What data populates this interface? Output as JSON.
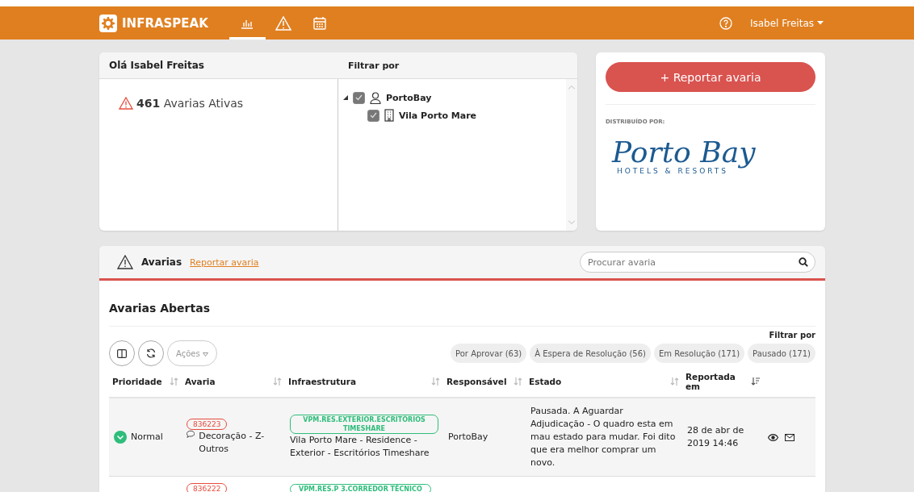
{
  "header": {
    "logo": "INFRASPEAK",
    "nav": [
      {
        "kind": "chart",
        "selected": true
      },
      {
        "kind": "alert",
        "selected": false
      },
      {
        "kind": "calendar",
        "selected": false
      }
    ],
    "user": "Isabel Freitas"
  },
  "welcome": {
    "title": "Olá Isabel Freitas",
    "count": "461",
    "count_label": "Avarias Ativas"
  },
  "filter": {
    "title": "Filtrar por",
    "tree": [
      {
        "label": "PortoBay",
        "kind": "client",
        "checked": true,
        "expanded": true,
        "children": [
          {
            "label": "Vila Porto Mare",
            "kind": "building",
            "checked": true
          }
        ]
      }
    ]
  },
  "promo": {
    "report_button": "+ Reportar avaria",
    "distributed_by": "DISTRIBUÍDO POR:",
    "brand": "Porto Bay",
    "brand_sub": "HOTELS & RESORTS"
  },
  "avarias": {
    "title": "Avarias",
    "report_link": "Reportar avaria",
    "search_placeholder": "Procurar avaria",
    "section_title": "Avarias Abertas",
    "filter_label": "Filtrar por",
    "actions": "Ações",
    "filters": [
      {
        "label": "Por Aprovar (63)"
      },
      {
        "label": "À Espera de Resolução (56)"
      },
      {
        "label": "Em Resolução (171)"
      },
      {
        "label": "Pausado (171)"
      }
    ],
    "columns": [
      {
        "label": "Prioridade",
        "sorted": false
      },
      {
        "label": "Avaria",
        "sorted": false
      },
      {
        "label": "Infraestrutura",
        "sorted": false
      },
      {
        "label": "Responsável",
        "sorted": false
      },
      {
        "label": "Estado",
        "sorted": false
      },
      {
        "label": "Reportada em",
        "sorted": true
      }
    ],
    "rows": [
      {
        "priority": "Normal",
        "code": "836223",
        "title": "Decoração - Z-Outros",
        "tag": "VPM.RES.EXTERIOR.ESCRITÓRIOS TIMESHARE",
        "infra": "Vila Porto Mare - Residence - Exterior - Escritórios Timeshare",
        "responsible": "PortoBay",
        "state": "Pausada. A Aguardar Adjudicação - O quadro esta em mau estado para mudar. Foi dito que era melhor comprar um novo.",
        "date": "28 de abr de 2019 14:46"
      },
      {
        "code": "836222",
        "tag": "VPM.RES.P 3.CORREDOR TÉCNICO"
      }
    ]
  }
}
